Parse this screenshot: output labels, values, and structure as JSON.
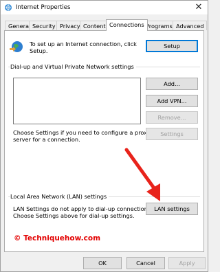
{
  "window": {
    "title": "Internet Properties",
    "close_glyph": "✕"
  },
  "tabs": [
    {
      "label": "General"
    },
    {
      "label": "Security"
    },
    {
      "label": "Privacy"
    },
    {
      "label": "Content"
    },
    {
      "label": "Connections"
    },
    {
      "label": "Programs"
    },
    {
      "label": "Advanced"
    }
  ],
  "setup": {
    "text_line1": "To set up an Internet connection, click",
    "text_line2": "Setup.",
    "button": "Setup"
  },
  "dialup": {
    "group_label": "Dial-up and Virtual Private Network settings",
    "add_button": "Add...",
    "add_vpn_button": "Add VPN...",
    "remove_button": "Remove...",
    "settings_button": "Settings",
    "proxy_line1": "Choose Settings if you need to configure a proxy",
    "proxy_line2": "server for a connection."
  },
  "lan": {
    "group_label": "Local Area Network (LAN) settings",
    "text_line1": "LAN Settings do not apply to dial-up connections.",
    "text_line2": "Choose Settings above for dial-up settings.",
    "button": "LAN settings"
  },
  "watermark": {
    "text": "© Techniquehow.com"
  },
  "footer": {
    "ok": "OK",
    "cancel": "Cancel",
    "apply": "Apply"
  },
  "colors": {
    "arrow": "#e8231b",
    "watermark": "#e30000",
    "default_border": "#0078d7"
  }
}
